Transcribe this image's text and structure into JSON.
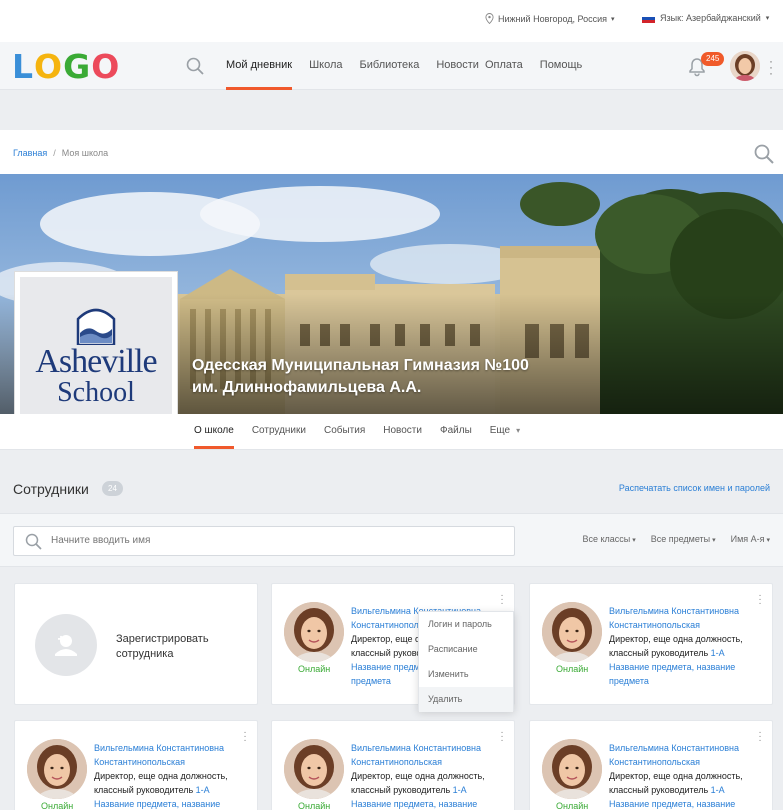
{
  "topbar": {
    "location": "Нижний Новгород, Россия",
    "language": "Язык: Азербайджанский"
  },
  "header": {
    "logo_letters": [
      {
        "ch": "L",
        "color": "#3a8fd8"
      },
      {
        "ch": "O",
        "color": "#f5b40f"
      },
      {
        "ch": "G",
        "color": "#3aaa35"
      },
      {
        "ch": "O",
        "color": "#ec4a5b"
      }
    ],
    "nav": [
      "Мой дневник",
      "Школа",
      "Библиотека",
      "Новости",
      "Оплата",
      "Помощь"
    ],
    "active_nav": 0,
    "notifications": "245"
  },
  "breadcrumb": {
    "home": "Главная",
    "separator": "/",
    "current": "Моя школа"
  },
  "school": {
    "logo_line1": "Asheville",
    "logo_line2": "School",
    "title_line1": "Одесская Муниципальная Гимназия №100",
    "title_line2": "им. Длиннофамильцева А.А."
  },
  "subnav": {
    "items": [
      "О школе",
      "Сотрудники",
      "События",
      "Новости",
      "Файлы",
      "Еще"
    ],
    "active": 0
  },
  "staff": {
    "title": "Сотрудники",
    "count": "24",
    "print_link": "Распечатать список имен и паролей",
    "search_placeholder": "Начните вводить имя",
    "filters": [
      "Все классы",
      "Все предметы",
      "Имя А-я"
    ],
    "register_label_line1": "Зарегистрировать",
    "register_label_line2": "сотрудника",
    "cards": [
      {
        "name": "Вильгельмина Константиновна Константинопольская",
        "role": "Директор, еще одна должность, классный руководитель",
        "class": "1-А",
        "subject": "Название предмета, название предмета",
        "status": "Онлайн"
      },
      {
        "name": "Вильгельмина Константиновна Константинопольская",
        "role": "Директор, еще одна должность, классный руководитель",
        "class": "1-А",
        "subject": "Название предмета, название предмета",
        "status": "Онлайн"
      },
      {
        "name": "Вильгельмина Константиновна Константинопольская",
        "role": "Директор, еще одна должность, классный руководитель",
        "class": "1-А",
        "subject": "Название предмета, название предмета",
        "status": "Онлайн"
      },
      {
        "name": "Вильгельмина Константиновна Константинопольская",
        "role": "Директор, еще одна должность, классный руководитель",
        "class": "1-А",
        "subject": "Название предмета, название предмета",
        "status": "Онлайн"
      },
      {
        "name": "Вильгельмина Константиновна Константинопольская",
        "role": "Директор, еще одна должность, классный руководитель",
        "class": "1-А",
        "subject": "Название предмета, название предмета",
        "status": "Онлайн"
      }
    ],
    "menu": [
      "Логин и пароль",
      "Расписание",
      "Изменить",
      "Удалить"
    ]
  },
  "colors": {
    "accent": "#f0592c",
    "link": "#2b7fd6",
    "online": "#3aaa35"
  }
}
